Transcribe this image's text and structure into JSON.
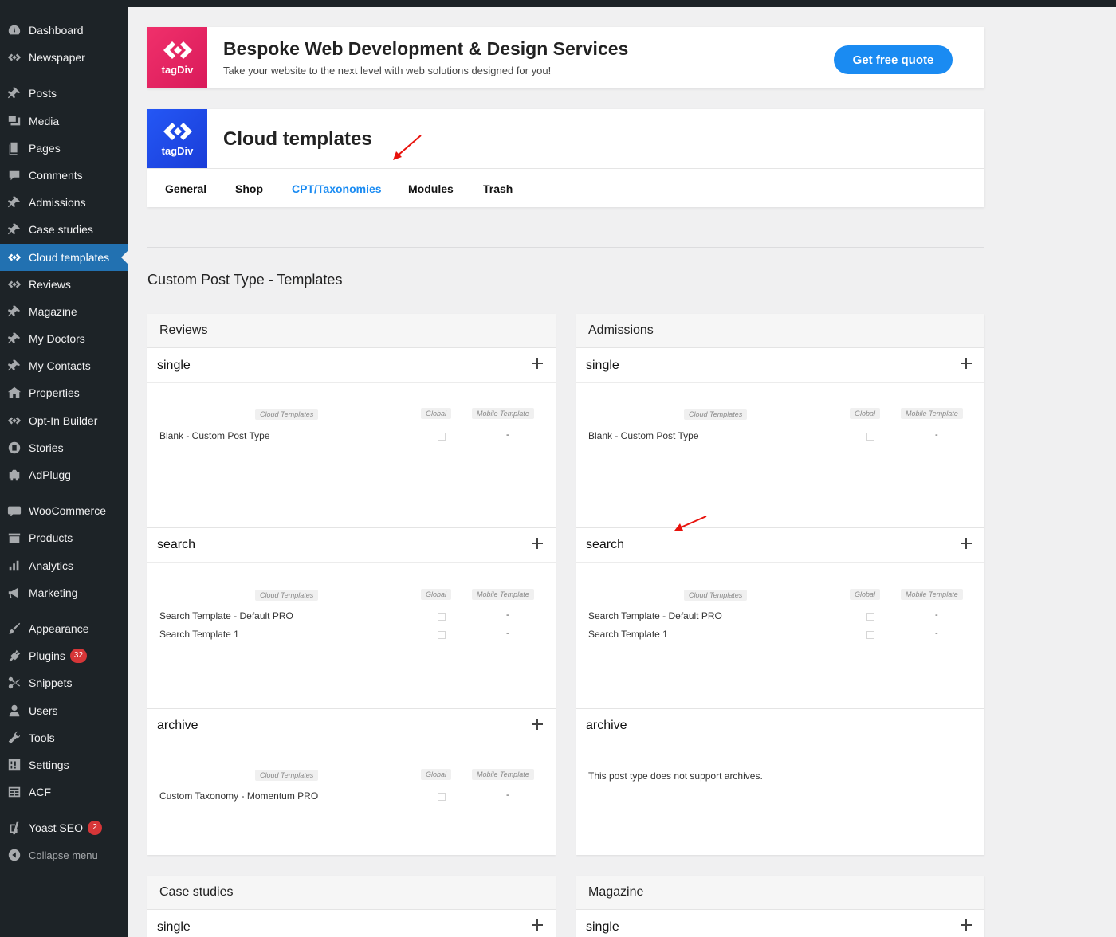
{
  "sidebar": {
    "items": [
      {
        "label": "Dashboard",
        "icon": "dashboard-icon"
      },
      {
        "label": "Newspaper",
        "icon": "tagdiv-icon"
      },
      {
        "label": "Posts",
        "icon": "pin-icon"
      },
      {
        "label": "Media",
        "icon": "media-icon"
      },
      {
        "label": "Pages",
        "icon": "pages-icon"
      },
      {
        "label": "Comments",
        "icon": "comments-icon"
      },
      {
        "label": "Admissions",
        "icon": "pin-icon"
      },
      {
        "label": "Case studies",
        "icon": "pin-icon"
      },
      {
        "label": "Cloud templates",
        "icon": "tagdiv-icon"
      },
      {
        "label": "Reviews",
        "icon": "tagdiv-icon"
      },
      {
        "label": "Magazine",
        "icon": "pin-icon"
      },
      {
        "label": "My Doctors",
        "icon": "pin-icon"
      },
      {
        "label": "My Contacts",
        "icon": "pin-icon"
      },
      {
        "label": "Properties",
        "icon": "properties-icon"
      },
      {
        "label": "Opt-In Builder",
        "icon": "tagdiv-icon"
      },
      {
        "label": "Stories",
        "icon": "stories-icon"
      },
      {
        "label": "AdPlugg",
        "icon": "adplugg-icon"
      },
      {
        "label": "WooCommerce",
        "icon": "woo-icon"
      },
      {
        "label": "Products",
        "icon": "products-icon"
      },
      {
        "label": "Analytics",
        "icon": "analytics-icon"
      },
      {
        "label": "Marketing",
        "icon": "megaphone-icon"
      },
      {
        "label": "Appearance",
        "icon": "brush-icon"
      },
      {
        "label": "Plugins",
        "icon": "plugin-icon",
        "badge": "32"
      },
      {
        "label": "Snippets",
        "icon": "scissors-icon"
      },
      {
        "label": "Users",
        "icon": "user-icon"
      },
      {
        "label": "Tools",
        "icon": "wrench-icon"
      },
      {
        "label": "Settings",
        "icon": "settings-icon"
      },
      {
        "label": "ACF",
        "icon": "acf-icon"
      },
      {
        "label": "Yoast SEO",
        "icon": "yoast-icon",
        "badge": "2"
      },
      {
        "label": "Collapse menu",
        "icon": "collapse-icon"
      }
    ],
    "active_color": "#2271b1"
  },
  "banner": {
    "logo_label": "tagDiv",
    "title": "Bespoke Web Development & Design Services",
    "subtitle": "Take your website to the next level with web solutions designed for you!",
    "button": "Get free quote"
  },
  "cloud": {
    "logo_label": "tagDiv",
    "title": "Cloud templates",
    "tabs": [
      "General",
      "Shop",
      "CPT/Taxonomies",
      "Modules",
      "Trash"
    ],
    "active_tab": "CPT/Taxonomies"
  },
  "section_title": "Custom Post Type - Templates",
  "columns": {
    "cloud": "Cloud Templates",
    "global": "Global",
    "mobile": "Mobile Template"
  },
  "panels": {
    "reviews": {
      "title": "Reviews",
      "single": {
        "label": "single",
        "rows": [
          {
            "name": "Blank - Custom Post Type",
            "mobile": "-"
          }
        ]
      },
      "search": {
        "label": "search",
        "rows": [
          {
            "name": "Search Template - Default PRO",
            "mobile": "-"
          },
          {
            "name": "Search Template 1",
            "mobile": "-"
          }
        ]
      },
      "archive": {
        "label": "archive",
        "rows": [
          {
            "name": "Custom Taxonomy - Momentum PRO",
            "mobile": "-"
          }
        ]
      }
    },
    "admissions": {
      "title": "Admissions",
      "single": {
        "label": "single",
        "rows": [
          {
            "name": "Blank - Custom Post Type",
            "mobile": "-"
          }
        ]
      },
      "search": {
        "label": "search",
        "rows": [
          {
            "name": "Search Template - Default PRO",
            "mobile": "-"
          },
          {
            "name": "Search Template 1",
            "mobile": "-"
          }
        ]
      },
      "archive": {
        "label": "archive",
        "note": "This post type does not support archives."
      }
    },
    "case_studies": {
      "title": "Case studies",
      "single": {
        "label": "single"
      }
    },
    "magazine": {
      "title": "Magazine",
      "single": {
        "label": "single"
      }
    }
  }
}
